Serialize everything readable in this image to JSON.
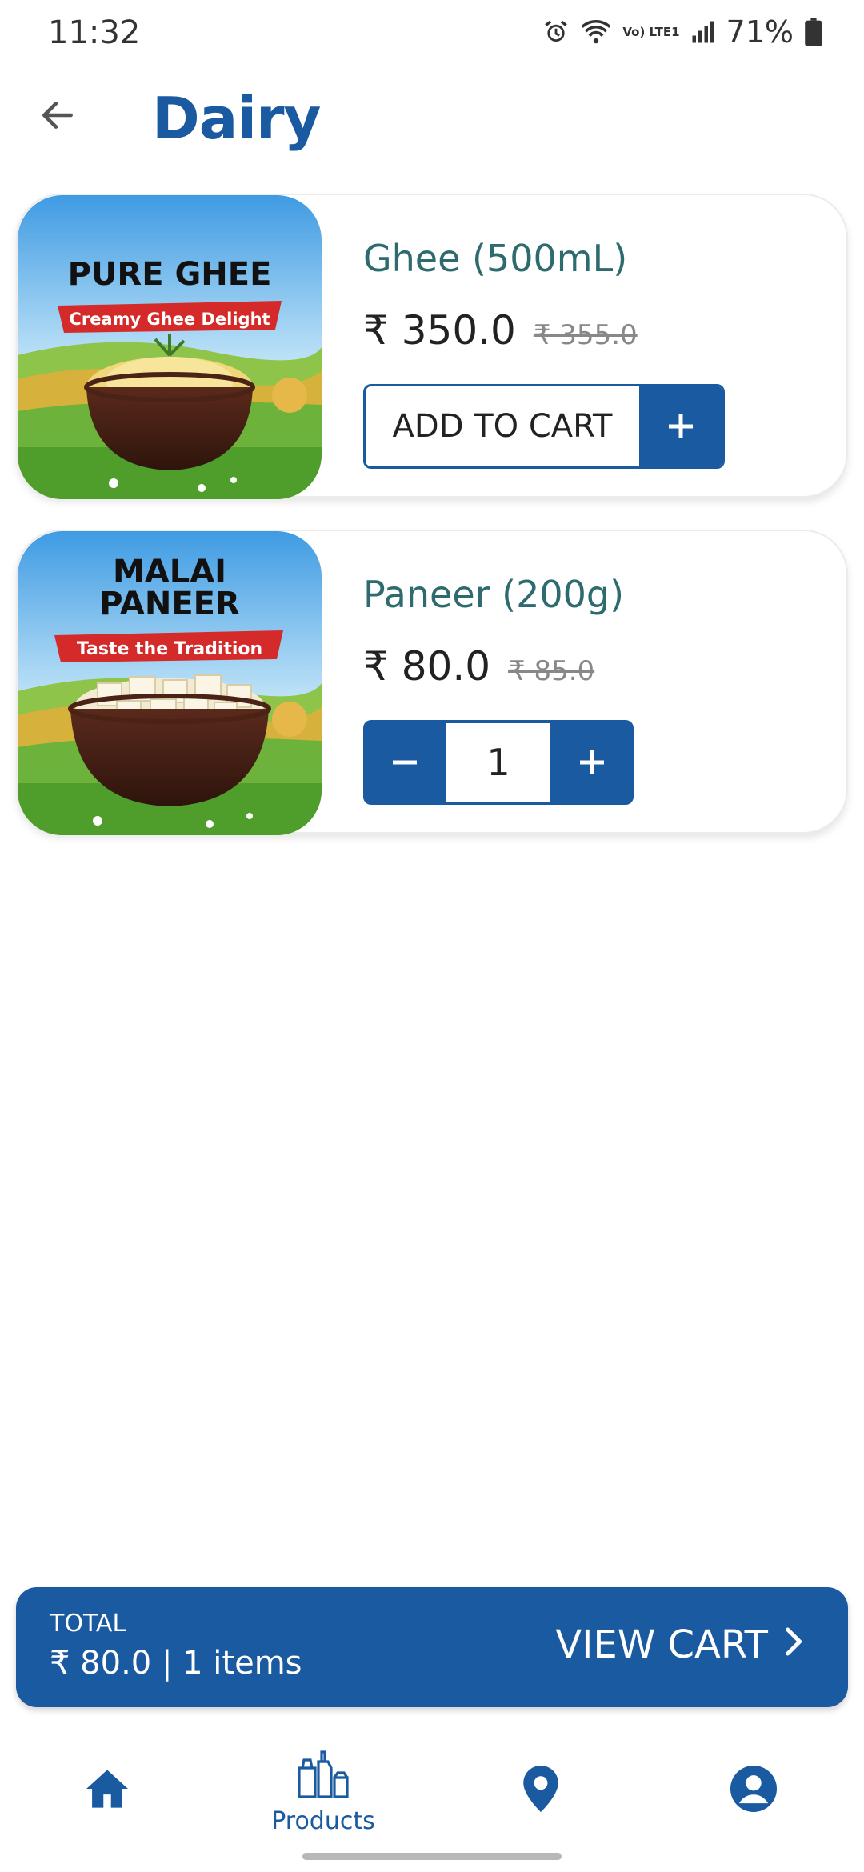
{
  "status_bar": {
    "time": "11:32",
    "network_label": "Vo) LTE1",
    "battery": "71%",
    "icons": [
      "alarm-icon",
      "wifi-icon",
      "signal-icon",
      "battery-icon"
    ]
  },
  "header": {
    "title": "Dairy",
    "back_icon": "arrow-left-icon"
  },
  "products": [
    {
      "name": "Ghee (500mL)",
      "price": "₹ 350.0",
      "mrp": "₹ 355.0",
      "action": "ADD TO CART",
      "image_headline": "PURE GHEE",
      "image_tagline": "Creamy Ghee Delight"
    },
    {
      "name": "Paneer (200g)",
      "price": "₹ 80.0",
      "mrp": "₹ 85.0",
      "quantity": "1",
      "image_headline_line1": "MALAI",
      "image_headline_line2": "PANEER",
      "image_tagline": "Taste the Tradition"
    }
  ],
  "cart_bar": {
    "total_label": "TOTAL",
    "total_value": "₹ 80.0 | 1 items",
    "action": "VIEW CART"
  },
  "bottom_nav": {
    "items": [
      {
        "icon": "home-icon",
        "label": ""
      },
      {
        "icon": "products-icon",
        "label": "Products"
      },
      {
        "icon": "location-pin-icon",
        "label": ""
      },
      {
        "icon": "account-icon",
        "label": ""
      }
    ]
  },
  "colors": {
    "primary": "#1a5aa0",
    "product_name": "#2e6b6e",
    "banner_red": "#d42a2a"
  }
}
